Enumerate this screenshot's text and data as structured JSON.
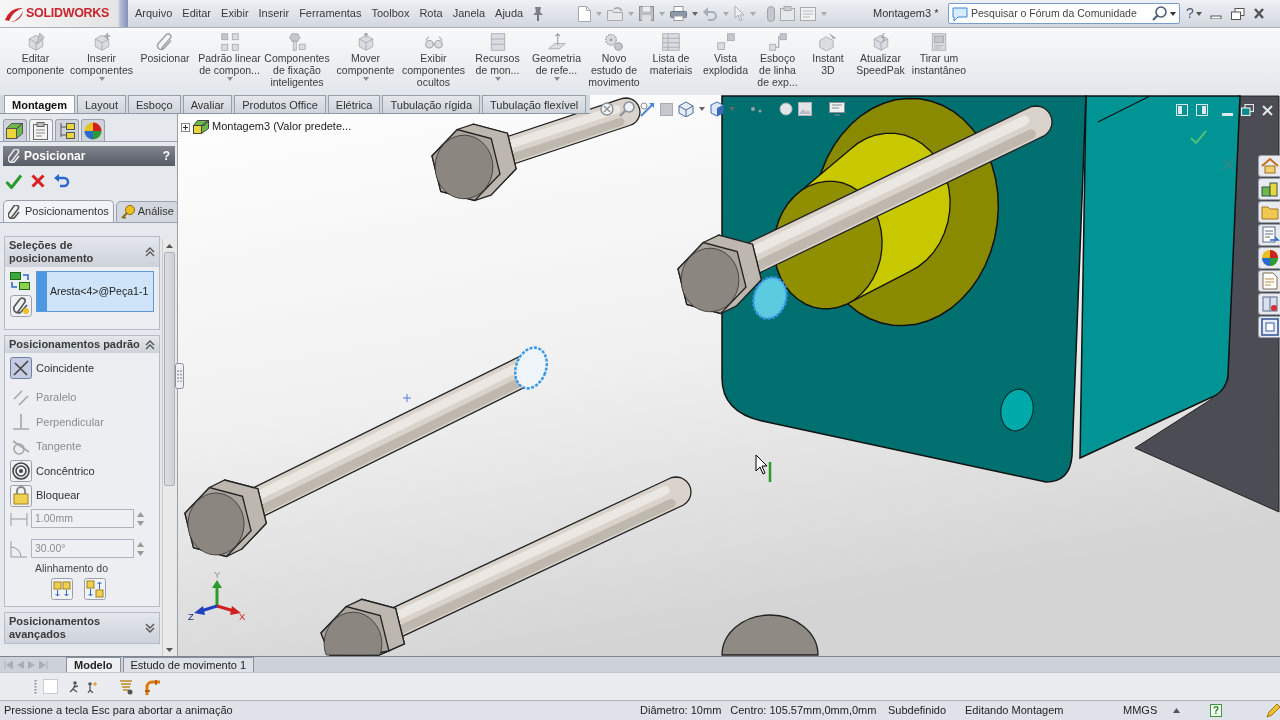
{
  "title_bar": {
    "logo": "SOLIDWORKS",
    "menu": [
      "Arquivo",
      "Editar",
      "Exibir",
      "Inserir",
      "Ferramentas",
      "Toolbox",
      "Rota",
      "Janela",
      "Ajuda"
    ],
    "document_title": "Montagem3 *",
    "search": {
      "placeholder": "Pesquisar o Fórum da Comunidade"
    },
    "help": "?"
  },
  "ribbon": [
    {
      "label": "Editar\ncomponente",
      "dropdown": false
    },
    {
      "label": "Inserir\ncomponentes",
      "dropdown": true
    },
    {
      "label": "Posicionar",
      "dropdown": false
    },
    {
      "label": "Padrão linear\nde compon...",
      "dropdown": true
    },
    {
      "label": "Componentes\nde fixação\ninteligentes",
      "dropdown": false
    },
    {
      "label": "Mover\ncomponente",
      "dropdown": true
    },
    {
      "label": "Exibir\ncomponentes\nocultos",
      "dropdown": false
    },
    {
      "label": "Recursos\nde mon...",
      "dropdown": true
    },
    {
      "label": "Geometria\nde refe...",
      "dropdown": true
    },
    {
      "label": "Novo\nestudo de\nmovimento",
      "dropdown": false
    },
    {
      "label": "Lista de\nmateriais",
      "dropdown": false
    },
    {
      "label": "Vista\nexplodida",
      "dropdown": false
    },
    {
      "label": "Esboço\nde linha\nde exp...",
      "dropdown": false
    },
    {
      "label": "Instant\n3D",
      "dropdown": false
    },
    {
      "label": "Atualizar\nSpeedPak",
      "dropdown": false
    },
    {
      "label": "Tirar um\ninstantâneo",
      "dropdown": false
    }
  ],
  "tabs": [
    {
      "label": "Montagem",
      "selected": true
    },
    {
      "label": "Layout",
      "selected": false
    },
    {
      "label": "Esboço",
      "selected": false
    },
    {
      "label": "Avaliar",
      "selected": false
    },
    {
      "label": "Produtos Office",
      "selected": false
    },
    {
      "label": "Elétrica",
      "selected": false
    },
    {
      "label": "Tubulação rígida",
      "selected": false
    },
    {
      "label": "Tubulação flexível",
      "selected": false
    }
  ],
  "property_panel": {
    "tabs": [
      {
        "selected": false
      },
      {
        "selected": true
      },
      {
        "selected": false
      },
      {
        "selected": false
      }
    ],
    "title": "Posicionar",
    "help": "?",
    "subtabs": [
      {
        "label": "Posicionamentos",
        "selected": true
      },
      {
        "label": "Análise",
        "selected": false
      }
    ],
    "groups": [
      {
        "title": "Seleções de\nposicionamento",
        "expanded": true,
        "items": [
          "Aresta<4>@Peça1-1"
        ]
      },
      {
        "title": "Posicionamentos padrão",
        "expanded": true,
        "mates": [
          {
            "label": "Coincidente",
            "selected": true,
            "disabled": false
          },
          {
            "label": "Paralelo",
            "selected": false,
            "disabled": true
          },
          {
            "label": "Perpendicular",
            "selected": false,
            "disabled": true
          },
          {
            "label": "Tangente",
            "selected": false,
            "disabled": true
          },
          {
            "label": "Concêntrico",
            "selected": false,
            "disabled": false
          },
          {
            "label": "Bloquear",
            "selected": false,
            "disabled": false
          }
        ],
        "distance": {
          "value": "1.00mm",
          "disabled": true
        },
        "angle": {
          "value": "30.00°",
          "disabled": true
        },
        "alignment_label": "Alinhamento do"
      },
      {
        "title": "Posicionamentos\navançados",
        "expanded": false
      }
    ]
  },
  "viewport": {
    "tree": {
      "label": "Montagem3 (Valor predete...",
      "expanded": false
    },
    "axes": {
      "x": "X",
      "y": "Y",
      "z": "Z"
    }
  },
  "bottom_tabs": [
    {
      "label": "Modelo",
      "selected": true
    },
    {
      "label": "Estudo de movimento 1",
      "selected": false
    }
  ],
  "status_bar": {
    "message": "Pressione a tecla Esc para abortar a animação",
    "diameter": "Diâmetro: 10mm",
    "center": "Centro: 105.57mm,0mm,0mm",
    "state": "Subdefinido",
    "mode": "Editando Montagem",
    "units": "MMGS",
    "help": "?"
  }
}
